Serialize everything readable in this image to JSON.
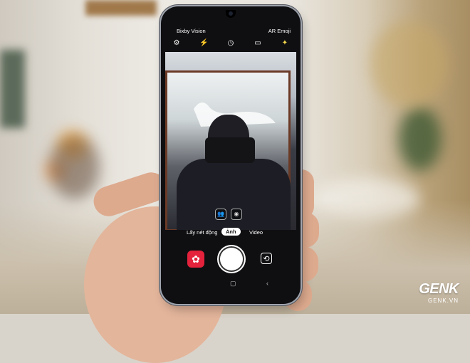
{
  "camera_ui": {
    "left_label": "Bixby Vision",
    "right_label": "AR Emoji",
    "mode_left": "Lấy nét động",
    "mode_active": "Ảnh",
    "mode_right": "Video"
  },
  "watermark": {
    "logo": "GENK",
    "site": "GENK.VN"
  },
  "icons": {
    "settings": "gear-icon",
    "flash": "flash-off-icon",
    "timer": "timer-icon",
    "ratio": "aspect-ratio-icon",
    "filter": "magic-wand-icon",
    "gallery": "flower-icon",
    "switch": "camera-switch-icon"
  }
}
